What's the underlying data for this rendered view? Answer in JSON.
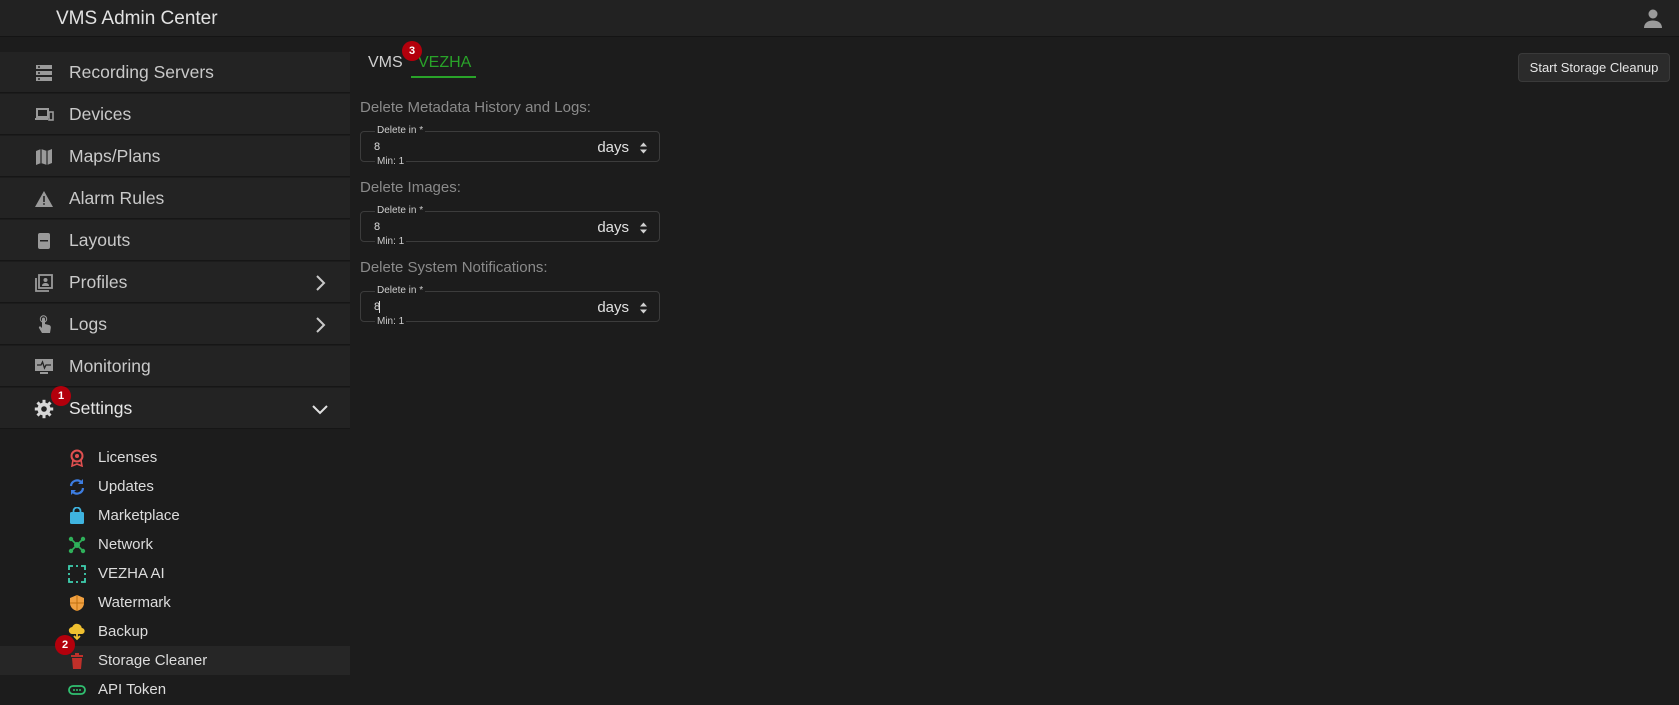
{
  "app": {
    "title": "VMS Admin Center"
  },
  "badges": {
    "settings": "1",
    "storage_cleaner": "2",
    "vezha_tab": "3"
  },
  "sidebar": {
    "items": [
      {
        "label": "Recording Servers",
        "icon": "server-icon"
      },
      {
        "label": "Devices",
        "icon": "devices-icon"
      },
      {
        "label": "Maps/Plans",
        "icon": "map-icon"
      },
      {
        "label": "Alarm Rules",
        "icon": "warning-icon"
      },
      {
        "label": "Layouts",
        "icon": "layouts-icon"
      },
      {
        "label": "Profiles",
        "icon": "profiles-icon"
      },
      {
        "label": "Logs",
        "icon": "touch-icon"
      },
      {
        "label": "Monitoring",
        "icon": "monitor-icon"
      },
      {
        "label": "Settings",
        "icon": "gear-icon"
      }
    ],
    "settings_sub": [
      {
        "label": "Licenses",
        "icon": "license-icon",
        "color": "#e05050"
      },
      {
        "label": "Updates",
        "icon": "refresh-icon",
        "color": "#3d7de0"
      },
      {
        "label": "Marketplace",
        "icon": "bag-icon",
        "color": "#3fb4e0"
      },
      {
        "label": "Network",
        "icon": "network-icon",
        "color": "#2fb05a"
      },
      {
        "label": "VEZHA AI",
        "icon": "ai-frame-icon",
        "color": "#3fd0b0"
      },
      {
        "label": "Watermark",
        "icon": "shield-icon",
        "color": "#f0a040"
      },
      {
        "label": "Backup",
        "icon": "cloud-icon",
        "color": "#f0c030"
      },
      {
        "label": "Storage Cleaner",
        "icon": "trash-icon",
        "color": "#c0302a"
      },
      {
        "label": "API Token",
        "icon": "token-icon",
        "color": "#30c070"
      }
    ]
  },
  "main": {
    "tabs": [
      {
        "label": "VMS"
      },
      {
        "label": "VEZHA"
      }
    ],
    "cleanup_button": "Start Storage Cleanup",
    "sections": [
      {
        "title": "Delete Metadata History and Logs:",
        "field_label": "Delete in *",
        "value": "8",
        "unit": "days",
        "hint": "Min: 1"
      },
      {
        "title": "Delete Images:",
        "field_label": "Delete in *",
        "value": "8",
        "unit": "days",
        "hint": "Min: 1"
      },
      {
        "title": "Delete System Notifications:",
        "field_label": "Delete in *",
        "value": "8",
        "unit": "days",
        "hint": "Min: 1"
      }
    ]
  },
  "colors": {
    "accent_green": "#29a329",
    "badge_red": "#b3000c"
  }
}
